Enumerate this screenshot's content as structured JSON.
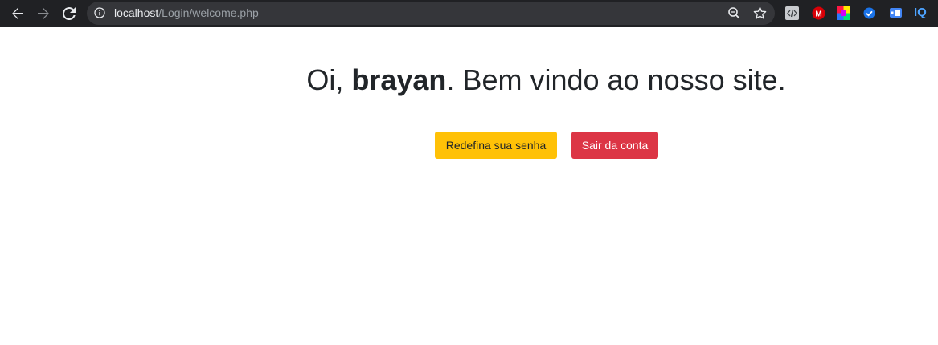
{
  "browser": {
    "address": {
      "host": "localhost",
      "path": "/Login/welcome.php"
    },
    "icons": [
      "back-icon",
      "forward-icon",
      "reload-icon",
      "site-info-icon",
      "zoom-icon",
      "bookmark-star-icon"
    ],
    "extensions": [
      "code-extension-icon",
      "mega-extension-icon",
      "color-picker-extension-icon",
      "checkmark-extension-icon",
      "screen-extension-icon",
      "iq-extension-icon"
    ],
    "extension_iq_label": "IQ",
    "extension_mega_label": "M"
  },
  "welcome": {
    "prefix": "Oi, ",
    "username": "brayan",
    "suffix": ". Bem vindo ao nosso site."
  },
  "actions": {
    "reset_password_label": "Redefina sua senha",
    "logout_label": "Sair da conta"
  },
  "colors": {
    "warning": "#ffc107",
    "danger": "#dc3545",
    "toolbar": "#202124"
  }
}
